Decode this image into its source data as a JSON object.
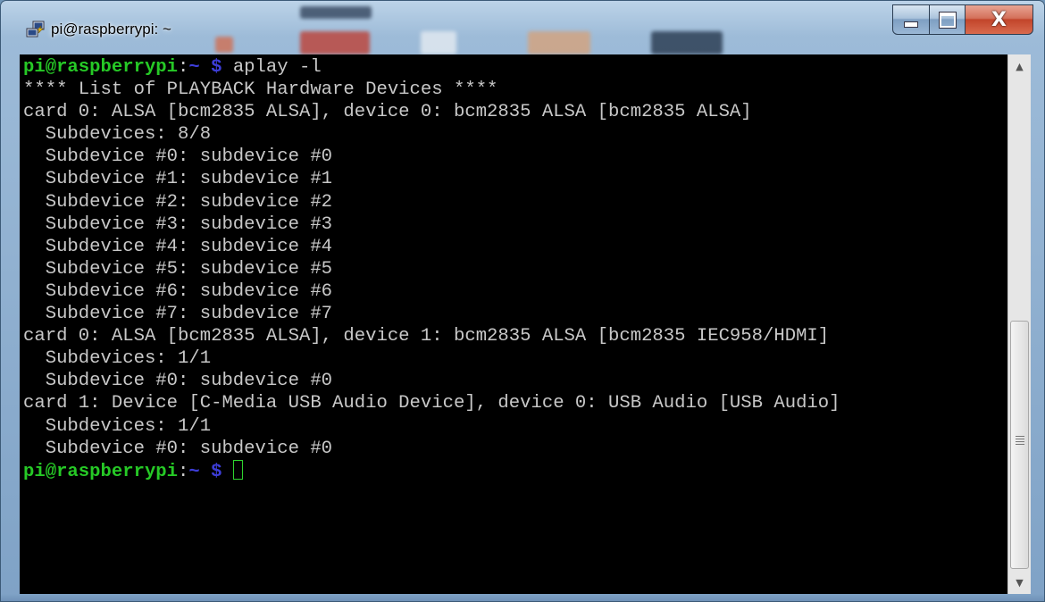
{
  "window": {
    "title": "pi@raspberrypi: ~"
  },
  "controls": {
    "close_label": "X"
  },
  "prompt": {
    "user_host": "pi@raspberrypi",
    "colon": ":",
    "path": "~",
    "dollar": "$"
  },
  "command": "aplay -l",
  "output": [
    "**** List of PLAYBACK Hardware Devices ****",
    "card 0: ALSA [bcm2835 ALSA], device 0: bcm2835 ALSA [bcm2835 ALSA]",
    "  Subdevices: 8/8",
    "  Subdevice #0: subdevice #0",
    "  Subdevice #1: subdevice #1",
    "  Subdevice #2: subdevice #2",
    "  Subdevice #3: subdevice #3",
    "  Subdevice #4: subdevice #4",
    "  Subdevice #5: subdevice #5",
    "  Subdevice #6: subdevice #6",
    "  Subdevice #7: subdevice #7",
    "card 0: ALSA [bcm2835 ALSA], device 1: bcm2835 ALSA [bcm2835 IEC958/HDMI]",
    "  Subdevices: 1/1",
    "  Subdevice #0: subdevice #0",
    "card 1: Device [C-Media USB Audio Device], device 0: USB Audio [USB Audio]",
    "  Subdevices: 1/1",
    "  Subdevice #0: subdevice #0"
  ],
  "icons": {
    "window_icon": "putty-icon",
    "minimize": "minimize-icon",
    "maximize": "maximize-icon",
    "close": "close-icon",
    "scroll_up": "scroll-up-arrow-icon",
    "scroll_down": "scroll-down-arrow-icon"
  },
  "colors": {
    "prompt_user": "#26c926",
    "prompt_path": "#3d3dd8",
    "terminal_bg": "#000000",
    "terminal_fg": "#c8c8c8"
  }
}
